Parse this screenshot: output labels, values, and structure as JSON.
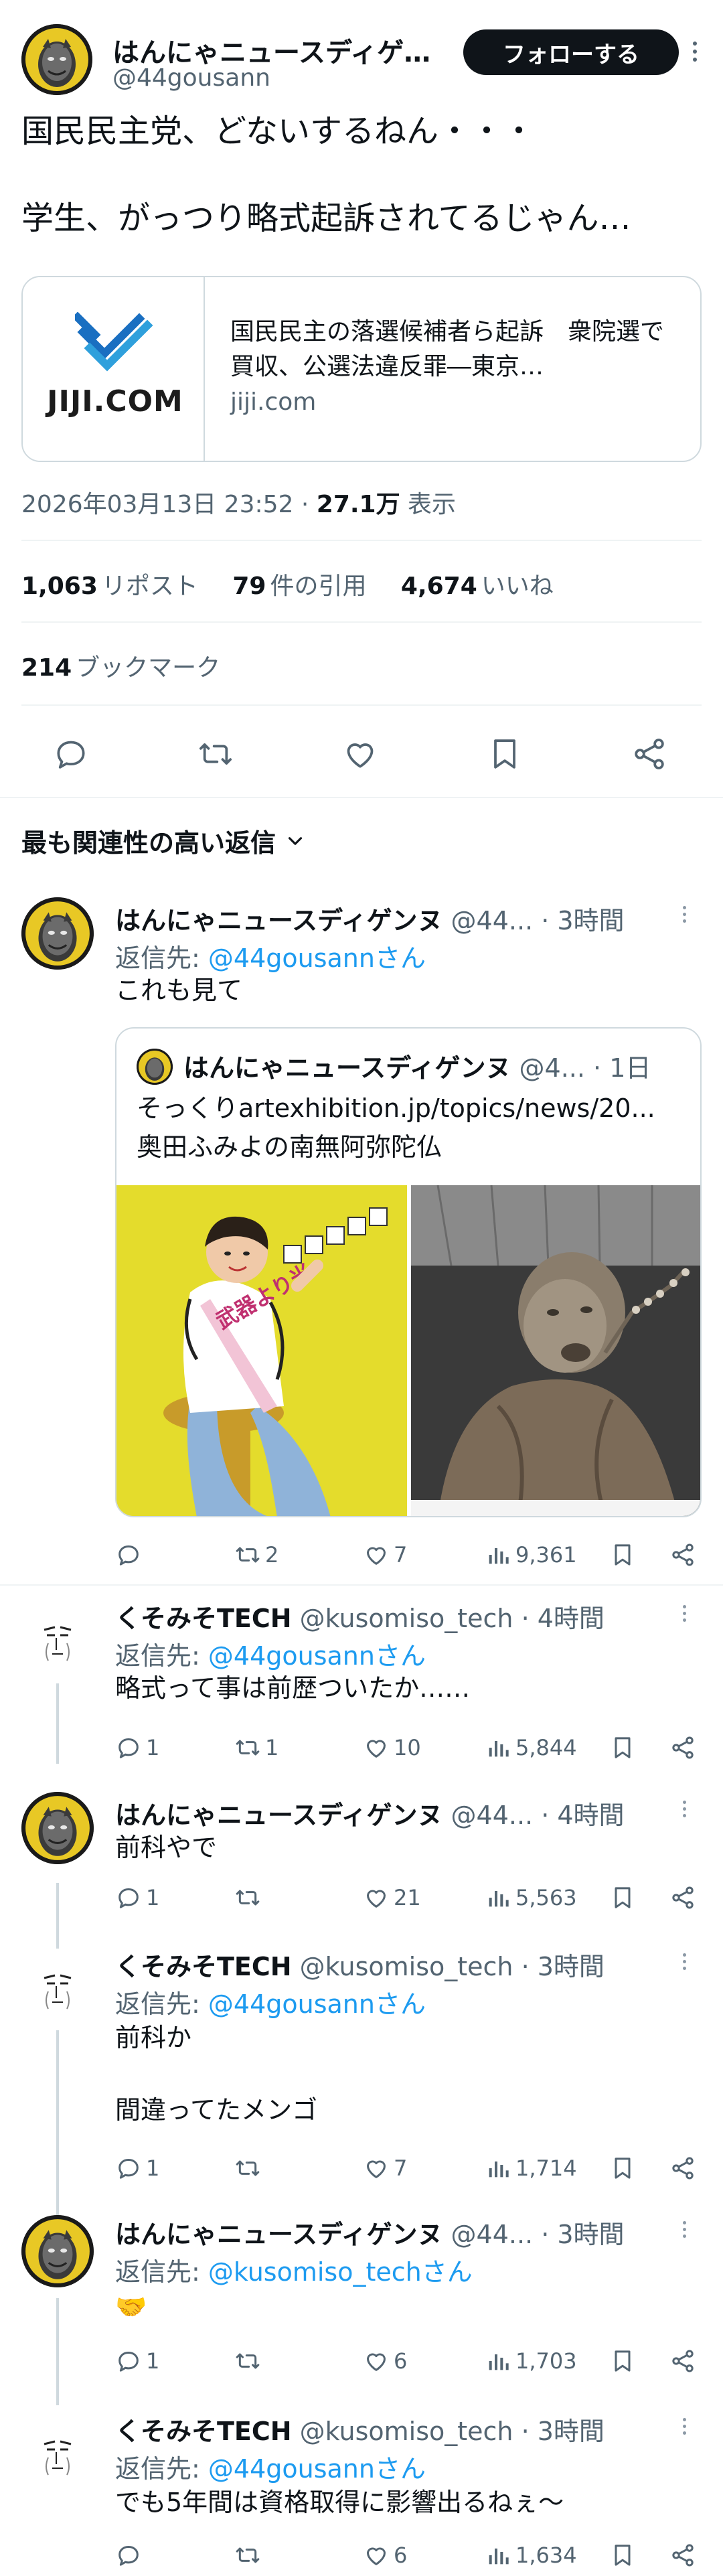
{
  "main": {
    "author_name": "はんにゃニュースディゲ…",
    "handle": "@44gousann",
    "follow_label": "フォローする",
    "text_line1": "国民民主党、どないするねん・・・",
    "text_line2": "学生、がっつり略式起訴されてるじゃん…",
    "link_card": {
      "logo_text": "JIJI.COM",
      "title": "国民民主の落選候補者ら起訴　衆院選で買収、公選法違反罪―東京…",
      "domain": "jiji.com"
    },
    "timestamp": "2026年03月13日 23:52",
    "views_count": "27.1万",
    "views_label": " 表示",
    "reposts_count": "1,063",
    "reposts_label": "リポスト",
    "quotes_count": "79",
    "quotes_label": "件の引用",
    "likes_count": "4,674",
    "likes_label": "いいね",
    "bookmarks_count": "214",
    "bookmarks_label": "ブックマーク",
    "icons": [
      "reply-icon",
      "retweet-icon",
      "like-icon",
      "bookmark-icon",
      "share-icon"
    ]
  },
  "sort_label": "最も関連性の高い返信",
  "replies": [
    {
      "name": "はんにゃニュースディゲンヌ",
      "handle": "@44...",
      "time": " · 3時間",
      "reply_to_prefix": "返信先: ",
      "reply_to": "@44gousannさん",
      "text": "これも見て",
      "quote": {
        "name": "はんにゃニュースディゲンヌ",
        "handle": "@4...",
        "time": " · 1日",
        "line1": "そっくりartexhibition.jp/topics/news/20...",
        "line2": "奥田ふみよの南無阿弥陀仏",
        "sash_text": "武器より米"
      },
      "replies_count": "",
      "retweets_count": "2",
      "likes_count": "7",
      "views_count": "9,361"
    },
    {
      "name": "くそみそTECH",
      "handle": "@kusomiso_tech",
      "time": " · 4時間",
      "reply_to_prefix": "返信先: ",
      "reply_to": "@44gousannさん",
      "text": "略式って事は前歴ついたか……",
      "replies_count": "1",
      "retweets_count": "1",
      "likes_count": "10",
      "views_count": "5,844"
    },
    {
      "name": "はんにゃニュースディゲンヌ",
      "handle": "@44...",
      "time": " · 4時間",
      "text": "前科やで",
      "replies_count": "1",
      "retweets_count": "",
      "likes_count": "21",
      "views_count": "5,563"
    },
    {
      "name": "くそみそTECH",
      "handle": "@kusomiso_tech",
      "time": " · 3時間",
      "reply_to_prefix": "返信先: ",
      "reply_to": "@44gousannさん",
      "text_line1": "前科か",
      "text_line2": "間違ってたメンゴ",
      "replies_count": "1",
      "retweets_count": "",
      "likes_count": "7",
      "views_count": "1,714"
    },
    {
      "name": "はんにゃニュースディゲンヌ",
      "handle": "@44...",
      "time": " · 3時間",
      "reply_to_prefix": "返信先: ",
      "reply_to": "@kusomiso_techさん",
      "text": "🤝",
      "replies_count": "1",
      "retweets_count": "",
      "likes_count": "6",
      "views_count": "1,703"
    },
    {
      "name": "くそみそTECH",
      "handle": "@kusomiso_tech",
      "time": " · 3時間",
      "reply_to_prefix": "返信先: ",
      "reply_to": "@44gousannさん",
      "text": "でも5年間は資格取得に影響出るねぇ〜",
      "replies_count": "",
      "retweets_count": "",
      "likes_count": "6",
      "views_count": "1,634"
    }
  ],
  "colors": {
    "text": "#0f1419",
    "secondary": "#536471",
    "link": "#1d9bf0",
    "border": "#cfd9de",
    "follow_bg": "#0f1419"
  }
}
